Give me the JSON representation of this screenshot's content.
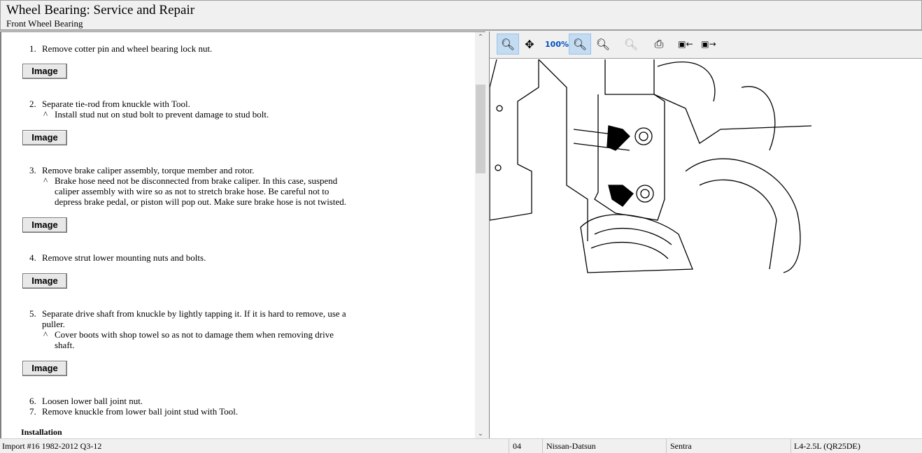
{
  "header": {
    "title": "Wheel Bearing:  Service and Repair",
    "subtitle": "Front Wheel Bearing"
  },
  "steps": [
    {
      "num": "1.",
      "lines": [
        "Remove cotter pin and wheel bearing lock nut."
      ],
      "subs": []
    },
    {
      "num": "2.",
      "lines": [
        "Separate tie-rod from knuckle with Tool."
      ],
      "subs": [
        "Install stud nut on stud bolt to prevent damage to stud bolt."
      ]
    },
    {
      "num": "3.",
      "lines": [
        "Remove brake caliper assembly, torque member and rotor."
      ],
      "subs": [
        "Brake hose need not be disconnected from brake caliper. In this case, suspend",
        "caliper assembly with wire so as not to stretch brake hose. Be careful not to",
        "depress brake pedal, or piston will pop out. Make sure brake hose is not twisted."
      ]
    },
    {
      "num": "4.",
      "lines": [
        "Remove strut lower mounting nuts and bolts."
      ],
      "subs": []
    },
    {
      "num": "5.",
      "lines": [
        "Separate drive shaft from knuckle by lightly tapping it. If it is hard to remove, use a",
        "puller."
      ],
      "subs": [
        "Cover boots with shop towel so as not to damage them when removing drive",
        "shaft."
      ]
    },
    {
      "num": "6.",
      "lines": [
        "Loosen lower ball joint nut."
      ],
      "subs": []
    },
    {
      "num": "7.",
      "lines": [
        "Remove knuckle from lower ball joint stud with Tool."
      ],
      "subs": []
    }
  ],
  "sub_marker": "^",
  "image_button": "Image",
  "installation": "Installation",
  "toolbar": [
    "zoom-in",
    "pan",
    "zoom-100",
    "zoom-fit",
    "zoom-width",
    "zoom-out",
    "print",
    "previous-image",
    "next-image"
  ],
  "status": {
    "source": "Import #16 1982-2012 Q3-12",
    "year": "04",
    "make": "Nissan-Datsun",
    "model": "Sentra",
    "engine": "L4-2.5L (QR25DE)"
  }
}
